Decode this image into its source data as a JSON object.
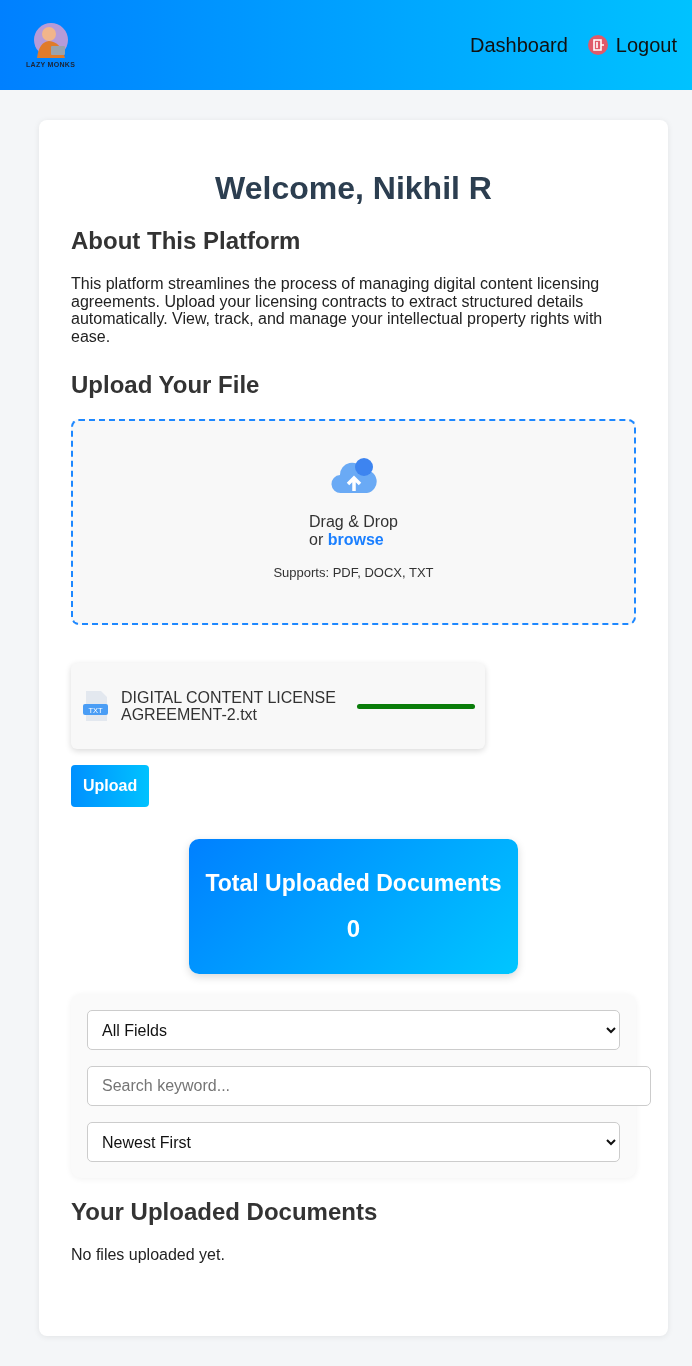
{
  "header": {
    "logo_text": "LAZY MONKS",
    "nav": [
      {
        "label": "Dashboard",
        "kind": "link"
      },
      {
        "label": "Logout",
        "kind": "logout"
      }
    ]
  },
  "welcome": "Welcome, Nikhil R",
  "about": {
    "heading": "About This Platform",
    "text": "This platform streamlines the process of managing digital content licensing agreements. Upload your licensing contracts to extract structured details automatically. View, track, and manage your intellectual property rights with ease."
  },
  "upload": {
    "heading": "Upload Your File",
    "drop_text": "Drag & Drop",
    "or_text": "or",
    "browse_link": "browse",
    "supports": "Supports: PDF, DOCX, TXT",
    "files": [
      {
        "name": "DIGITAL CONTENT LICENSE AGREEMENT-2.txt",
        "type_label": "TXT",
        "level": 1
      }
    ],
    "button": "Upload"
  },
  "stats": {
    "title": "Total Uploaded Documents",
    "count": "0"
  },
  "filters": {
    "field_select": "All Fields",
    "search": {
      "placeholder": "Search keyword..."
    },
    "sort_select": "Newest First"
  },
  "documents": {
    "heading": "Your Uploaded Documents",
    "empty_text": "No files uploaded yet."
  }
}
